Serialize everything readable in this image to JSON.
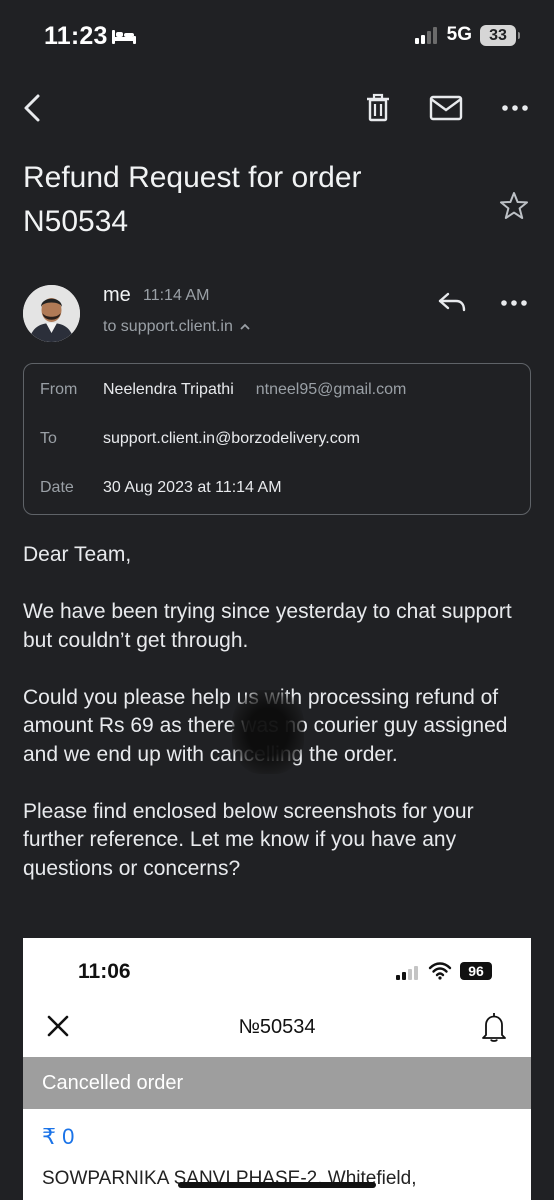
{
  "status_bar": {
    "time": "11:23",
    "network": "5G",
    "battery": "33"
  },
  "toolbar": {
    "icons": [
      "back-arrow-icon",
      "trash-icon",
      "mail-icon",
      "more-icon"
    ]
  },
  "email": {
    "subject": "Refund Request for order N50534",
    "sender": "me",
    "time": "11:14 AM",
    "to_summary": "to support.client.in",
    "details": {
      "from_label": "From",
      "from_name": "Neelendra Tripathi",
      "from_email": "ntneel95@gmail.com",
      "to_label": "To",
      "to_value": "support.client.in@borzodelivery.com",
      "date_label": "Date",
      "date_value": "30 Aug 2023 at 11:14 AM"
    },
    "body": {
      "p1": "Dear Team,",
      "p2": "We have been trying since yesterday to chat support but couldn’t get through.",
      "p3": "Could you please help us with processing refund of amount Rs 69 as there was no courier guy assigned and we end up with cancelling the order.",
      "p4": "Please find enclosed below screenshots for your further reference. Let me know if you have any questions or concerns?"
    }
  },
  "embedded_screenshot": {
    "time": "11:06",
    "battery": "96",
    "order_number": "№50534",
    "status_banner": "Cancelled order",
    "price": "₹ 0",
    "address": "SOWPARNIKA SANVI PHASE-2, Whitefield,"
  },
  "colors": {
    "background": "#202124",
    "accent_blue": "#1a73e8",
    "banner_gray": "#9e9e9e"
  }
}
